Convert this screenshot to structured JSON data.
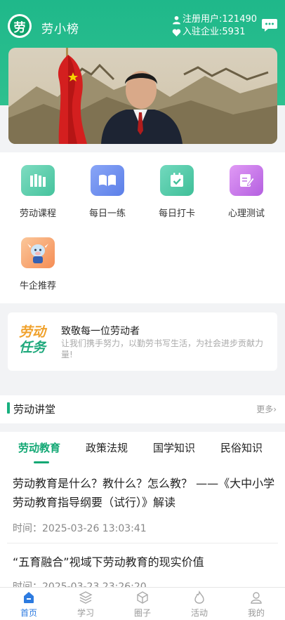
{
  "header": {
    "logo_char": "劳",
    "app_name": "劳小榜",
    "registered_users": "注册用户:121490",
    "enterprises": "入驻企业:5931"
  },
  "banner": {
    "alt": "banner"
  },
  "grid": [
    {
      "label": "劳动课程",
      "icon": "books-icon",
      "color": "#5fd0b0"
    },
    {
      "label": "每日一练",
      "icon": "open-book-icon",
      "color": "#6f8ff2"
    },
    {
      "label": "每日打卡",
      "icon": "check-in-icon",
      "color": "#55cfae"
    },
    {
      "label": "心理测试",
      "icon": "edit-note-icon",
      "color": "#c87ae8"
    },
    {
      "label": "牛企推荐",
      "icon": "cow-mascot-icon",
      "color": "#f7a36f"
    }
  ],
  "mission": {
    "art_line1": "劳动",
    "art_line2": "任务",
    "title": "致敬每一位劳动者",
    "desc": "让我们携手努力，以勤劳书写生活，为社会进步贡献力量!"
  },
  "section": {
    "title": "劳动讲堂",
    "more": "更多›"
  },
  "tabs": [
    "劳动教育",
    "政策法规",
    "国学知识",
    "民俗知识"
  ],
  "articles": [
    {
      "title": "劳动教育是什么？教什么？怎么教？ ——《大中小学劳动教育指导纲要（试行）》解读",
      "time": "时间：2025-03-26 13:03:41"
    },
    {
      "title": "“五育融合”视域下劳动教育的现实价值",
      "time": "时间：2025-03-23 23:26:20"
    }
  ],
  "nav": [
    {
      "label": "首页",
      "icon": "home-icon"
    },
    {
      "label": "学习",
      "icon": "layers-icon"
    },
    {
      "label": "圈子",
      "icon": "cube-icon"
    },
    {
      "label": "活动",
      "icon": "flame-icon"
    },
    {
      "label": "我的",
      "icon": "user-icon"
    }
  ],
  "colors": {
    "brand": "#1fb88a",
    "tab_active": "#12a874",
    "nav_active": "#2d7be0"
  }
}
